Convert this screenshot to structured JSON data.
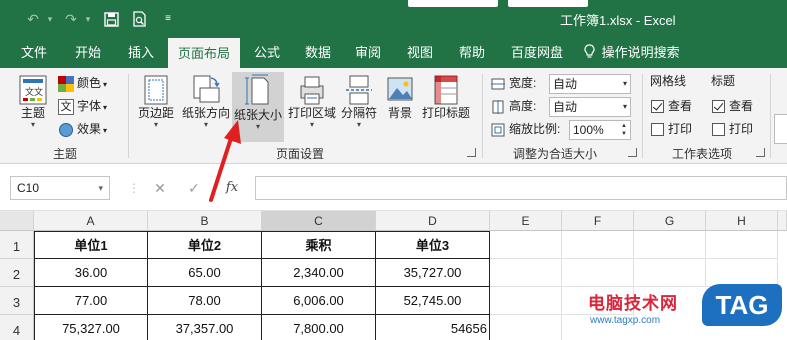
{
  "titlebar": {
    "undo_icon": "undo-icon",
    "redo_icon": "redo-icon",
    "save_icon": "save-icon",
    "print_preview_icon": "print-preview-icon",
    "title": "工作簿1.xlsx  -  Excel"
  },
  "tabs": [
    {
      "label": "文件"
    },
    {
      "label": "开始"
    },
    {
      "label": "插入"
    },
    {
      "label": "页面布局",
      "active": true
    },
    {
      "label": "公式"
    },
    {
      "label": "数据"
    },
    {
      "label": "审阅"
    },
    {
      "label": "视图"
    },
    {
      "label": "帮助"
    },
    {
      "label": "百度网盘"
    },
    {
      "label": "操作说明搜索",
      "icon": "lightbulb-icon"
    }
  ],
  "ribbon": {
    "themes_group": {
      "theme_button": "主题",
      "colors": "颜色",
      "fonts": "字体",
      "effects": "效果",
      "label": "主题"
    },
    "page_setup_group": {
      "margins": "页边距",
      "orientation": "纸张方向",
      "size": "纸张大小",
      "print_area": "打印区域",
      "breaks": "分隔符",
      "background": "背景",
      "print_titles": "打印标题",
      "label": "页面设置"
    },
    "scale_group": {
      "width_label": "宽度:",
      "width_value": "自动",
      "height_label": "高度:",
      "height_value": "自动",
      "scale_label": "缩放比例:",
      "scale_value": "100%",
      "label": "调整为合适大小"
    },
    "sheet_options_group": {
      "gridlines_header": "网格线",
      "gridlines_view": "查看",
      "gridlines_print": "打印",
      "headings_header": "标题",
      "headings_view": "查看",
      "headings_print": "打印",
      "label": "工作表选项",
      "gridlines_view_checked": true,
      "gridlines_print_checked": false,
      "headings_view_checked": true,
      "headings_print_checked": false
    }
  },
  "formula_bar": {
    "name_box": "C10",
    "cancel_icon": "✕",
    "enter_icon": "✓",
    "function_icon": "fx",
    "formula": ""
  },
  "grid": {
    "columns": [
      "A",
      "B",
      "C",
      "D",
      "E",
      "F",
      "G",
      "H"
    ],
    "rows": [
      "1",
      "2",
      "3",
      "4"
    ],
    "cells": [
      [
        "单位1",
        "单位2",
        "乘积",
        "单位3"
      ],
      [
        "36.00",
        "65.00",
        "2,340.00",
        "35,727.00"
      ],
      [
        "77.00",
        "78.00",
        "6,006.00",
        "52,745.00"
      ],
      [
        "75,327.00",
        "37,357.00",
        "7,800.00",
        "54656"
      ]
    ]
  },
  "annotation": {
    "arrow_color": "#e02020"
  },
  "watermark": {
    "text_cn": "电脑技术网",
    "url": "www.tagxp.com",
    "logo": "TAG"
  }
}
